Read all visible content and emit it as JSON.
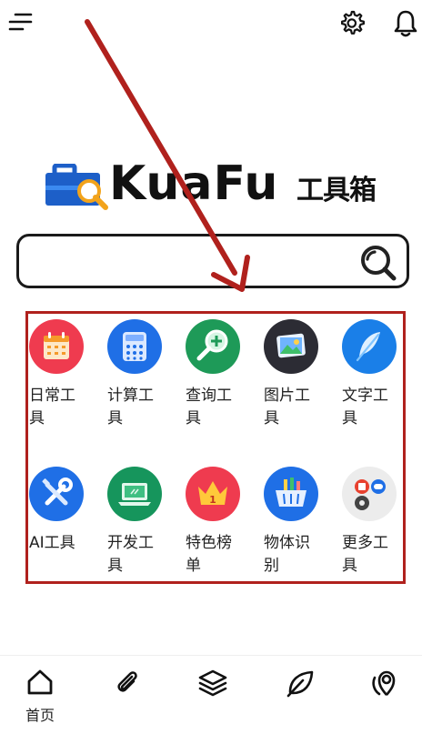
{
  "header": {
    "menu_icon": "menu-icon",
    "settings_icon": "gear-icon",
    "notification_icon": "bell-icon"
  },
  "logo": {
    "brand": "KuaFu",
    "suffix": "工具箱"
  },
  "search": {
    "placeholder": "",
    "value": ""
  },
  "tools": [
    {
      "label": "日常工具",
      "icon": "calendar-icon",
      "color": "#ef3b4f"
    },
    {
      "label": "计算工具",
      "icon": "calculator-icon",
      "color": "#1f6fe6"
    },
    {
      "label": "查询工具",
      "icon": "magnifier-plus-icon",
      "color": "#1e9a58"
    },
    {
      "label": "图片工具",
      "icon": "picture-icon",
      "color": "#2c2c34"
    },
    {
      "label": "文字工具",
      "icon": "feather-icon",
      "color": "#1a7fe8"
    },
    {
      "label": "AI工具",
      "icon": "wrench-screwdriver-icon",
      "color": "#1f6fe6"
    },
    {
      "label": "开发工具",
      "icon": "laptop-icon",
      "color": "#16955c"
    },
    {
      "label": "特色榜单",
      "icon": "crown-icon",
      "color": "#ef3b4f"
    },
    {
      "label": "物体识别",
      "icon": "basket-icon",
      "color": "#1f6fe6"
    },
    {
      "label": "更多工具",
      "icon": "more-apps-icon",
      "color": "#ececec"
    }
  ],
  "bottom_nav": [
    {
      "label": "首页",
      "icon": "home-icon"
    },
    {
      "label": "",
      "icon": "paperclip-icon"
    },
    {
      "label": "",
      "icon": "layers-icon"
    },
    {
      "label": "",
      "icon": "leaf-icon"
    },
    {
      "label": "",
      "icon": "location-pin-icon"
    }
  ],
  "annotation_colors": {
    "highlight": "#b0211d"
  }
}
